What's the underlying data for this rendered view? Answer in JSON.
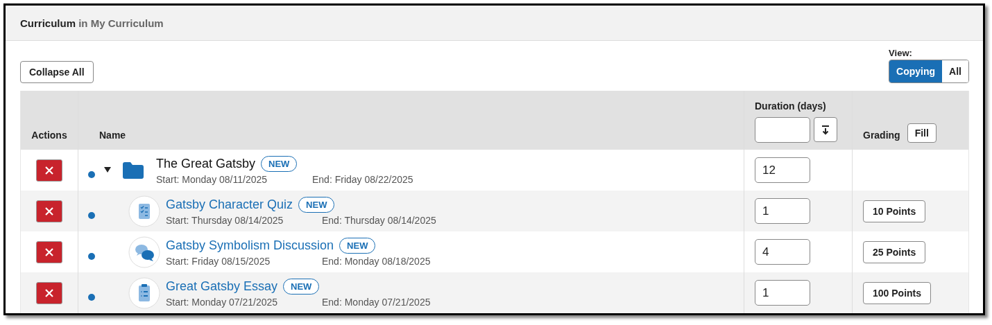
{
  "header": {
    "title": "Curriculum",
    "context": "in My Curriculum"
  },
  "collapse_button": "Collapse All",
  "view": {
    "label": "View:",
    "options": [
      {
        "label": "Copying",
        "selected": true
      },
      {
        "label": "All",
        "selected": false
      }
    ]
  },
  "table": {
    "columns": [
      "Actions",
      "Name",
      "Duration (days)",
      "Grading"
    ],
    "fill_button": "Fill",
    "rows": [
      {
        "kind": "folder",
        "name": "The Great Gatsby",
        "badge": "NEW",
        "start": "Start: Monday 08/11/2025",
        "end": "End: Friday 08/22/2025",
        "duration": "12",
        "expanded": true,
        "children": [
          {
            "kind": "quiz",
            "name": "Gatsby Character Quiz",
            "badge": "NEW",
            "start": "Start: Thursday 08/14/2025",
            "end": "End: Thursday 08/14/2025",
            "duration": "1",
            "grading": "10 Points"
          },
          {
            "kind": "discussion",
            "name": "Gatsby Symbolism Discussion",
            "badge": "NEW",
            "start": "Start: Friday 08/15/2025",
            "end": "End: Monday 08/18/2025",
            "duration": "4",
            "grading": "25 Points"
          },
          {
            "kind": "essay",
            "name": "Great Gatsby Essay",
            "badge": "NEW",
            "start": "Start: Monday 07/21/2025",
            "end": "End: Monday 07/21/2025",
            "duration": "1",
            "grading": "100 Points"
          }
        ]
      }
    ]
  }
}
